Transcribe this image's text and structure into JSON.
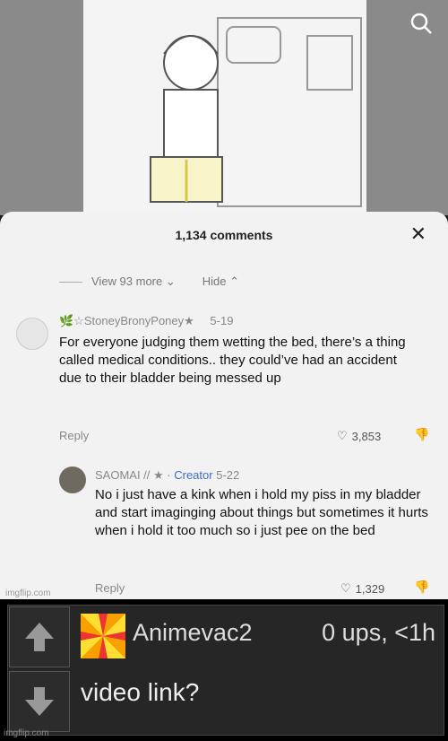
{
  "post": {
    "comment_count": "1,134 comments",
    "view_more": "View 93 more",
    "hide": "Hide",
    "comment1": {
      "username": "StoneyBronyPoney",
      "date": "5-19",
      "text": "For everyone judging them wetting the bed, there’s a thing called medical conditions.. they could’ve had an accident due to their bladder being messed up",
      "reply": "Reply",
      "likes": "3,853"
    },
    "comment2": {
      "username": "SAOMAI //",
      "creator": "Creator",
      "date": "5-22",
      "text": "No i just have a kink when i hold my piss in my bladder and start imaginging about things but sometimes it hurts when i hold it too much so i just pee on the bed",
      "reply": "Reply",
      "likes": "1,329"
    },
    "watermark": "imgflip.com"
  },
  "imgflip_comment": {
    "author": "Animevac2",
    "ups": "0 ups, <1h",
    "text": "video link?",
    "watermark": "imgflip.com"
  }
}
